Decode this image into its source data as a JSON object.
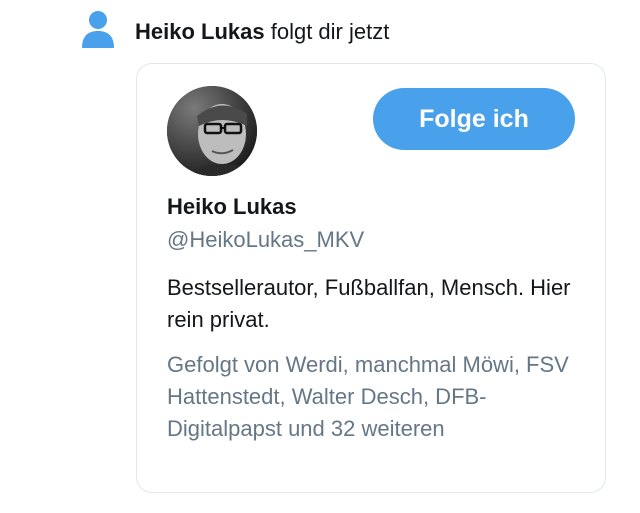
{
  "notification": {
    "user_name": "Heiko Lukas",
    "action_text": " folgt dir jetzt",
    "icon": "person-icon"
  },
  "profile_card": {
    "name": "Heiko Lukas",
    "handle": "@HeikoLukas_MKV",
    "bio": "Bestsellerautor, Fußballfan, Mensch. Hier rein privat.",
    "followed_by": "Gefolgt von Werdi, manchmal Möwi, FSV Hattenstedt, Walter Desch, DFB-Digitalpapst und 32 weiteren",
    "follow_button_label": "Folge ich"
  },
  "colors": {
    "accent": "#4aa1eb",
    "text": "#14171a",
    "secondary_text": "#657786",
    "border": "#e1e8ed"
  }
}
